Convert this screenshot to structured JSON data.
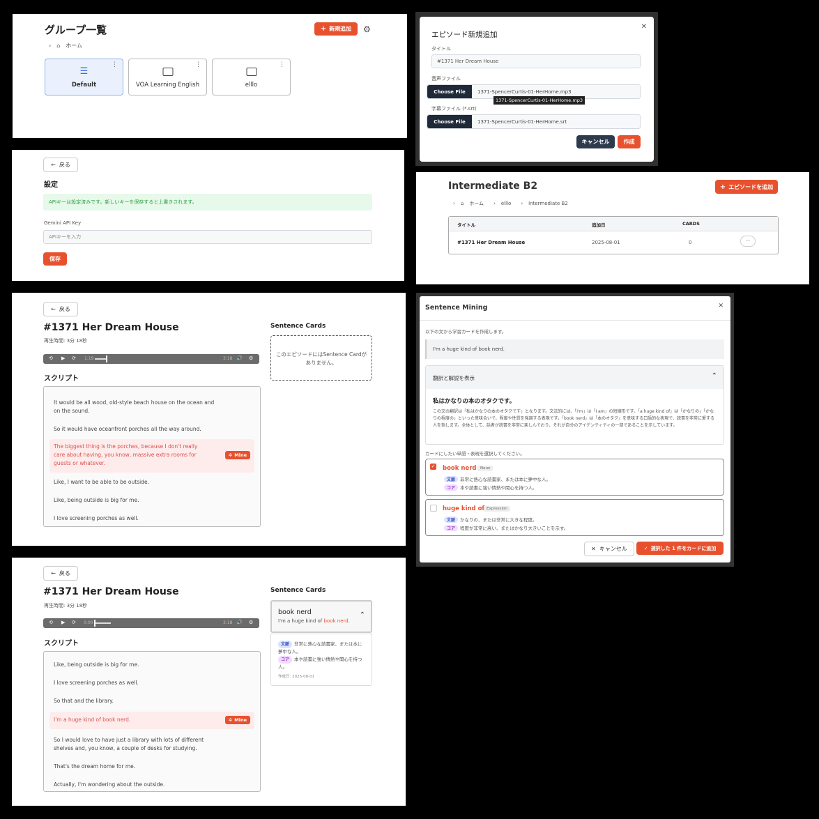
{
  "p1": {
    "title": "グループ一覧",
    "new_button": "新規追加",
    "breadcrumb_home": "ホーム",
    "groups": [
      "Default",
      "VOA Learning English",
      "elllo"
    ]
  },
  "p2": {
    "title": "エピソード新規追加",
    "title_label": "タイトル",
    "title_value": "#1371 Her Dream House",
    "audio_label": "音声ファイル",
    "choose_file": "Choose File",
    "audio_file": "1371-SpencerCurtis-01-HerHome.mp3",
    "tooltip": "1371-SpencerCurtis-01-HerHome.mp3",
    "subtitle_label": "字幕ファイル (*.srt)",
    "subtitle_file": "1371-SpencerCurtis-01-HerHome.srt",
    "cancel": "キャンセル",
    "create": "作成"
  },
  "p3": {
    "back": "戻る",
    "title": "設定",
    "alert": "APIキーは設定済みです。新しいキーを保存すると上書きされます。",
    "api_label": "Gemini API Key",
    "api_placeholder": "APIキーを入力",
    "save": "保存"
  },
  "p4": {
    "title": "Intermediate B2",
    "add_button": "エピソードを追加",
    "crumb_home": "ホーム",
    "crumb_group": "elllo",
    "crumb_current": "Intermediate B2",
    "col_title": "タイトル",
    "col_date": "追加日",
    "col_cards": "CARDS",
    "row_title": "#1371 Her Dream House",
    "row_date": "2025-08-01",
    "row_cards": "0",
    "row_menu": "···"
  },
  "p5": {
    "back": "戻る",
    "title": "#1371 Her Dream House",
    "duration": "再生時間: 3分 18秒",
    "time_start": "1:19",
    "time_end": "3:18",
    "script_heading": "スクリプト",
    "cards_heading": "Sentence Cards",
    "empty": "このエピソードにはSentence Cardがありません。",
    "lines": [
      "It would be all wood, old-style beach house on the ocean and on the sound.",
      "So it would have oceanfront porches all the way around.",
      "The biggest thing is the porches, because I don't really care about having, you know, massive extra rooms for guests or whatever.",
      "Like, I want to be able to be outside.",
      "Like, being outside is big for me.",
      "I love screening porches as well."
    ],
    "mine": "Mine"
  },
  "p6": {
    "title": "Sentence Mining",
    "intro": "以下の文から学習カードを作成します。",
    "sentence": "I'm a huge kind of book nerd.",
    "toggle": "翻訳と解説を表示",
    "translation": "私はかなりの本のオタクです。",
    "explanation": "この文の翻訳は「私はかなりの本のオタクです」となります。文法的には、「I'm」は「I am」の短縮形です。「a huge kind of」は「かなりの」「かなりの程度の」といった意味合いで、程度や性質を強調する表現です。「book nerd」は「本のオタク」を意味する口語的な表現で、読書を非常に愛する人を指します。全体として、話者が読書を非常に楽しんでおり、それが自分のアイデンティティの一部であることを示しています。",
    "select_prompt": "カードにしたい単語・表現を選択してください。",
    "items": [
      {
        "term": "book nerd",
        "pos": "Noun",
        "ctx_tag": "文脈",
        "ctx": "非常に熱心な読書家、または本に夢中な人。",
        "core_tag": "コア",
        "core": "本や読書に強い情熱や関心を持つ人。"
      },
      {
        "term": "huge kind of",
        "pos": "Expression",
        "ctx_tag": "文脈",
        "ctx": "かなりの、または非常に大きな程度。",
        "core_tag": "コア",
        "core": "程度が非常に高い、またはかなり大きいことを示す。"
      }
    ],
    "cancel": "キャンセル",
    "add": "選択した 1 件をカードに追加"
  },
  "p7": {
    "back": "戻る",
    "title": "#1371 Her Dream House",
    "duration": "再生時間: 3分 18秒",
    "time_start": "0:00",
    "time_end": "3:18",
    "script_heading": "スクリプト",
    "cards_heading": "Sentence Cards",
    "card_term": "book nerd",
    "card_sentence_pre": "I'm a huge kind of ",
    "card_sentence_hl": "book nerd",
    "card_sentence_post": ".",
    "card_ctx_tag": "文脈",
    "card_ctx": "非常に熱心な読書家、または本に夢中な人。",
    "card_core_tag": "コア",
    "card_core": "本や読書に強い情熱や関心を持つ人。",
    "card_created": "作成日: 2025-08-01",
    "lines": [
      "Like, being outside is big for me.",
      "I love screening porches as well.",
      "So that and the library.",
      "I'm a huge kind of book nerd.",
      "So I would love to have just a library with lots of different shelves and, you know, a couple of desks for studying.",
      "That's the dream home for me.",
      "Actually, I'm wondering about the outside."
    ],
    "mine": "Mine"
  }
}
